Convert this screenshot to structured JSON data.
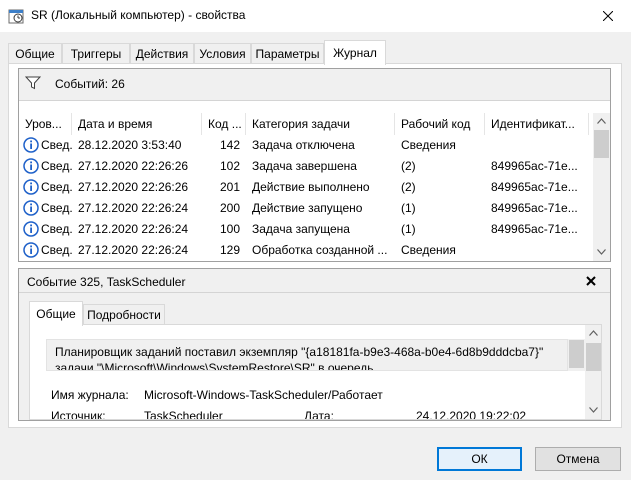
{
  "window": {
    "title": "SR (Локальный компьютер) - свойства",
    "icon": "task-scheduler-icon",
    "close_icon": "close-icon"
  },
  "tabs": [
    {
      "label": "Общие",
      "active": false
    },
    {
      "label": "Триггеры",
      "active": false
    },
    {
      "label": "Действия",
      "active": false
    },
    {
      "label": "Условия",
      "active": false
    },
    {
      "label": "Параметры",
      "active": false
    },
    {
      "label": "Журнал",
      "active": true
    }
  ],
  "events": {
    "filter_icon": "filter-icon",
    "count_label": "Событий: 26",
    "columns": [
      "Уров...",
      "Дата и время",
      "Код ...",
      "Категория задачи",
      "Рабочий код",
      "Идентификат..."
    ],
    "rows": [
      {
        "level": "Свед...",
        "datetime": "28.12.2020 3:53:40",
        "code": "142",
        "category": "Задача отключена",
        "opcode": "Сведения",
        "id": ""
      },
      {
        "level": "Свед...",
        "datetime": "27.12.2020 22:26:26",
        "code": "102",
        "category": "Задача завершена",
        "opcode": "(2)",
        "id": "849965ac-71e..."
      },
      {
        "level": "Свед...",
        "datetime": "27.12.2020 22:26:26",
        "code": "201",
        "category": "Действие выполнено",
        "opcode": "(2)",
        "id": "849965ac-71e..."
      },
      {
        "level": "Свед...",
        "datetime": "27.12.2020 22:26:24",
        "code": "200",
        "category": "Действие запущено",
        "opcode": "(1)",
        "id": "849965ac-71e..."
      },
      {
        "level": "Свед...",
        "datetime": "27.12.2020 22:26:24",
        "code": "100",
        "category": "Задача запущена",
        "opcode": "(1)",
        "id": "849965ac-71e..."
      },
      {
        "level": "Свед...",
        "datetime": "27.12.2020 22:26:24",
        "code": "129",
        "category": "Обработка созданной ...",
        "opcode": "Сведения",
        "id": ""
      }
    ]
  },
  "detail": {
    "title": "Событие 325, TaskScheduler",
    "tabs": [
      {
        "label": "Общие",
        "active": true
      },
      {
        "label": "Подробности",
        "active": false
      }
    ],
    "message_line1": "Планировщик заданий поставил экземпляр \"{a18181fa-b9e3-468a-b0e4-6d8b9dddcba7}\"",
    "message_line2": "задачи \"\\Microsoft\\Windows\\SystemRestore\\SR\" в очередь.",
    "log_name_label": "Имя журнала:",
    "log_name_value": "Microsoft-Windows-TaskScheduler/Работает",
    "source_label": "Источник:",
    "source_value": "TaskScheduler",
    "date_label": "Дата:",
    "date_value": "24.12.2020 19:22:02"
  },
  "buttons": {
    "ok": "ОК",
    "cancel": "Отмена"
  },
  "colors": {
    "accent": "#0078d7",
    "info_icon": "#1e60c9"
  }
}
